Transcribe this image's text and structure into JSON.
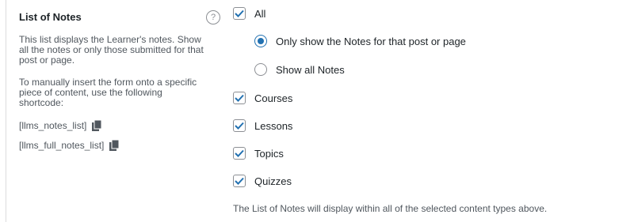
{
  "section": {
    "title": "List of Notes",
    "description_1": "This list displays the Learner's notes. Show all the notes or only those submitted for that post or page.",
    "description_2": "To manually insert the form onto a specific piece of content, use the following shortcode:",
    "shortcodes": [
      {
        "text": "[llms_notes_list]",
        "icon": "copy-icon"
      },
      {
        "text": "[llms_full_notes_list]",
        "icon": "copy-icon"
      }
    ],
    "help_icon": "?"
  },
  "options": {
    "all": {
      "label": "All",
      "checked": true
    },
    "scope": [
      {
        "label": "Only show the Notes for that post or page",
        "selected": true
      },
      {
        "label": "Show all Notes",
        "selected": false
      }
    ],
    "content_types": [
      {
        "label": "Courses",
        "checked": true
      },
      {
        "label": "Lessons",
        "checked": true
      },
      {
        "label": "Topics",
        "checked": true
      },
      {
        "label": "Quizzes",
        "checked": true
      }
    ]
  },
  "footnote": "The List of Notes will display within all of the selected content types above.",
  "colors": {
    "accent": "#2271b1",
    "border": "#8c8f94",
    "text": "#1d2327",
    "muted": "#50575e",
    "icon": "#50575e"
  }
}
